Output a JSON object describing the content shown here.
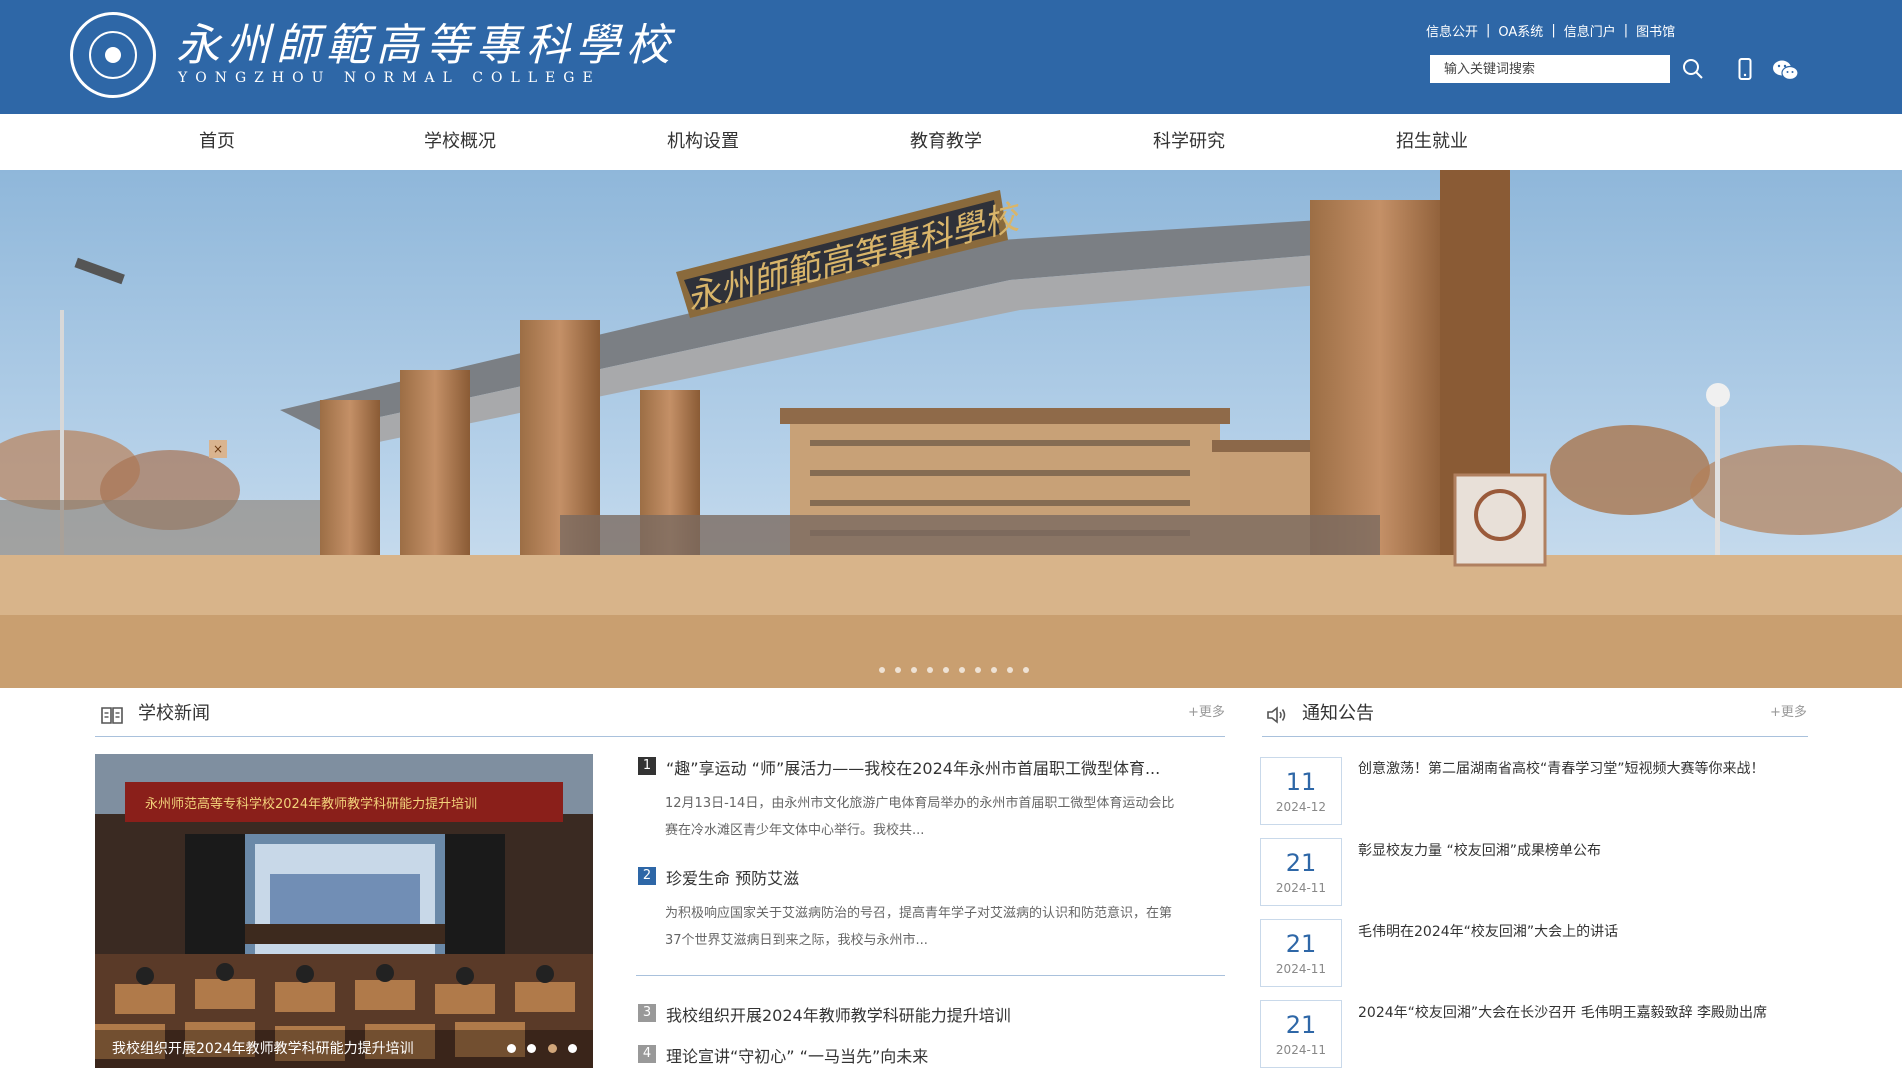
{
  "header": {
    "brand_cn": "永州師範高等專科學校",
    "brand_en": "YONGZHOU NORMAL COLLEGE",
    "top_links": [
      "信息公开",
      "OA系统",
      "信息门户",
      "图书馆"
    ],
    "top_link_sep": "|",
    "search_placeholder": "输入关键词搜索",
    "icons": {
      "search": "search-icon",
      "phone": "mobile-phone-icon",
      "wechat": "wechat-icon"
    }
  },
  "nav": {
    "items": [
      "首页",
      "学校概况",
      "机构设置",
      "教育教学",
      "科学研究",
      "招生就业"
    ]
  },
  "banner": {
    "close_label": "×",
    "gate_sign": "永州師範高等專科學校",
    "slide_count": 10,
    "active_slide": 2
  },
  "news": {
    "title": "学校新闻",
    "more": "+更多",
    "photo_caption": "我校组织开展2024年教师教学科研能力提升培训",
    "photo_banner_text": "永州师范高等专科学校2024年教师教学科研能力提升培训",
    "carousel_dots": 4,
    "carousel_active": 2,
    "items": [
      {
        "num": "1",
        "title": "“趣”享运动 “师”展活力——我校在2024年永州市首届职工微型体育...",
        "summary": "12月13日-14日，由永州市文化旅游广电体育局举办的永州市首届职工微型体育运动会比赛在冷水滩区青少年文体中心举行。我校共..."
      },
      {
        "num": "2",
        "title": "珍爱生命 预防艾滋",
        "summary": "为积极响应国家关于艾滋病防治的号召，提高青年学子对艾滋病的认识和防范意识，在第37个世界艾滋病日到来之际，我校与永州市..."
      },
      {
        "num": "3",
        "title": "我校组织开展2024年教师教学科研能力提升培训",
        "summary": ""
      },
      {
        "num": "4",
        "title": "理论宣讲“守初心” “一马当先”向未来",
        "summary": ""
      }
    ]
  },
  "notices": {
    "title": "通知公告",
    "more": "+更多",
    "items": [
      {
        "day": "11",
        "ym": "2024-12",
        "title": "创意激荡！第二届湖南省高校“青春学习堂”短视频大赛等你来战！"
      },
      {
        "day": "21",
        "ym": "2024-11",
        "title": "彰显校友力量 “校友回湘”成果榜单公布"
      },
      {
        "day": "21",
        "ym": "2024-11",
        "title": "毛伟明在2024年“校友回湘”大会上的讲话"
      },
      {
        "day": "21",
        "ym": "2024-11",
        "title": "2024年“校友回湘”大会在长沙召开 毛伟明王嘉毅致辞 李殿勋出席"
      }
    ]
  },
  "colors": {
    "brand_blue": "#2e67a7",
    "num_dark": "#333333",
    "num_active": "#2e67a7",
    "num_gray": "#999999"
  }
}
